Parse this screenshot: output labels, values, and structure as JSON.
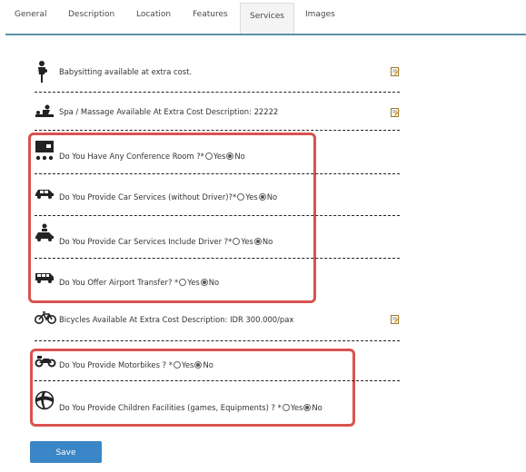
{
  "tabs": [
    {
      "label": "General"
    },
    {
      "label": "Description"
    },
    {
      "label": "Location"
    },
    {
      "label": "Features"
    },
    {
      "label": "Services"
    },
    {
      "label": "Images"
    }
  ],
  "active_tab": "Services",
  "services": [
    {
      "label": "Babysitting available at extra cost.",
      "icon": "babysitting-icon"
    },
    {
      "label": "Spa / Massage Available At Extra Cost Description: 22222",
      "icon": "massage-icon"
    },
    {
      "label": "Do You Have Any Conference Room ?*",
      "icon": "conference-room-icon",
      "yes": "Yes",
      "no": "No",
      "selected": "No"
    },
    {
      "label": "Do You Provide Car Services (without Driver)?*",
      "icon": "car-icon",
      "yes": "Yes",
      "no": "No",
      "selected": "No"
    },
    {
      "label": "Do You Provide Car Services Include Driver ?*",
      "icon": "car-with-driver-icon",
      "yes": "Yes",
      "no": "No",
      "selected": "No"
    },
    {
      "label": "Do You Offer Airport Transfer? *",
      "icon": "van-icon",
      "yes": "Yes",
      "no": "No",
      "selected": "No"
    },
    {
      "label": "Bicycles Available At Extra Cost Description: IDR 300.000/pax",
      "icon": "bicycle-icon"
    },
    {
      "label": "Do You Provide Motorbikes ? *",
      "icon": "motorbike-icon",
      "yes": "Yes",
      "no": "No",
      "selected": "No"
    },
    {
      "label": "Do You Provide Children Facilities (games, Equipments) ? *",
      "icon": "beach-ball-icon",
      "yes": "Yes",
      "no": "No",
      "selected": "No"
    }
  ],
  "save_label": "Save",
  "colors": {
    "highlight": "#d9534f",
    "save_button": "#3a86c6",
    "tab_underline": "#5b8fa8"
  }
}
